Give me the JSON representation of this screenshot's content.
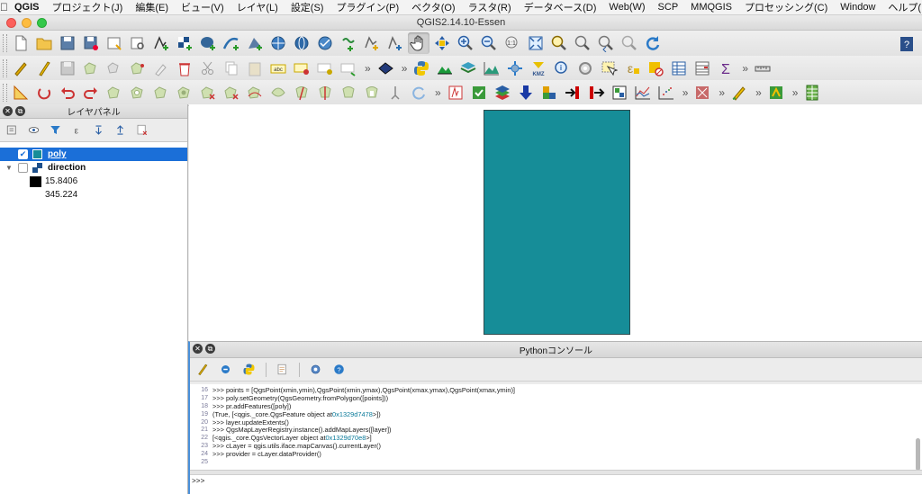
{
  "menubar": {
    "app": "QGIS",
    "items": [
      "プロジェクト(J)",
      "編集(E)",
      "ビュー(V)",
      "レイヤ(L)",
      "設定(S)",
      "プラグイン(P)",
      "ベクタ(O)",
      "ラスタ(R)",
      "データベース(D)",
      "Web(W)",
      "SCP",
      "MMQGIS",
      "プロセッシング(C)",
      "Window",
      "ヘルプ(H)"
    ]
  },
  "window": {
    "title": "QGIS2.14.10-Essen"
  },
  "layer_panel": {
    "title": "レイヤパネル",
    "layers": [
      {
        "name": "poly",
        "checked": true,
        "selected": true,
        "color": "#168d98"
      },
      {
        "name": "direction",
        "checked": false,
        "selected": false
      }
    ],
    "legend": [
      {
        "label": "15.8406",
        "color": "#000000"
      },
      {
        "label": "345.224",
        "color": "#ffffff"
      }
    ]
  },
  "map": {
    "polygon_color": "#168d98"
  },
  "console": {
    "title": "Pythonコンソール",
    "lines": [
      {
        "n": "16",
        "text": ">>> points = [QgsPoint(xmin,ymin),QgsPoint(xmin,ymax),QgsPoint(xmax,ymax),QgsPoint(xmax,ymin)]"
      },
      {
        "n": "17",
        "text": ">>> poly.setGeometry(QgsGeometry.fromPolygon([points]))"
      },
      {
        "n": "18",
        "text": ">>> pr.addFeatures([poly])"
      },
      {
        "n": "19",
        "text": "(True, [<qgis._core.QgsFeature object at ",
        "addr": "0x1329d7478",
        "tail": ">])"
      },
      {
        "n": "20",
        "text": ">>> layer.updateExtents()"
      },
      {
        "n": "21",
        "text": ">>> QgsMapLayerRegistry.instance().addMapLayers([layer])"
      },
      {
        "n": "22",
        "text": "[<qgis._core.QgsVectorLayer object at ",
        "addr": "0x1329d70e8",
        "tail": ">]"
      },
      {
        "n": "23",
        "text": ">>> cLayer = qgis.utils.iface.mapCanvas().currentLayer()"
      },
      {
        "n": "24",
        "text": ">>> provider = cLayer.dataProvider()"
      },
      {
        "n": "25",
        "text": ""
      }
    ],
    "prompt": ">>>"
  },
  "icons": {
    "toolbar1": [
      "new-project-icon",
      "open-project-icon",
      "save-project-icon",
      "save-as-icon",
      "new-print-composer-icon",
      "composer-manager-icon",
      "add-vector-layer-icon",
      "add-raster-layer-icon",
      "add-postgis-icon",
      "add-spatialite-icon",
      "add-mssql-icon",
      "add-wms-icon",
      "add-wcs-icon",
      "add-wfs-icon",
      "add-delimited-text-icon",
      "new-shapefile-icon",
      "new-spatialite-layer-icon",
      "pan-icon",
      "pan-to-selection-icon",
      "zoom-in-icon",
      "zoom-out-icon",
      "zoom-native-icon",
      "zoom-full-icon",
      "zoom-to-selection-icon",
      "zoom-to-layer-icon",
      "zoom-last-icon",
      "zoom-next-icon",
      "refresh-icon",
      "help-icon"
    ],
    "toolbar2": [
      "current-edits-icon",
      "toggle-editing-icon",
      "save-edits-icon",
      "add-feature-icon",
      "move-feature-icon",
      "node-tool-icon",
      "delete-selected-icon",
      "cut-features-icon",
      "copy-features-icon",
      "paste-features-icon",
      "label-icon",
      "pin-labels-icon",
      "show-hide-labels-icon",
      "move-label-icon",
      "python-console-icon",
      "raster-terrain-icon",
      "qgis-cloud-icon",
      "profile-icon",
      "gps-icon",
      "kmz-icon",
      "identify-icon",
      "select-icon",
      "select-by-expression-icon",
      "deselect-icon",
      "attribute-table-icon",
      "field-calculator-icon",
      "statistics-icon",
      "measure-icon"
    ],
    "toolbar3": [
      "digitize-icon",
      "rotate-icon",
      "undo-icon",
      "redo-icon",
      "simplify-icon",
      "add-ring-icon",
      "add-part-icon",
      "fill-ring-icon",
      "delete-ring-icon",
      "delete-part-icon",
      "reshape-icon",
      "offset-curve-icon",
      "split-features-icon",
      "split-parts-icon",
      "merge-features-icon",
      "merge-attributes-icon",
      "rotate-point-symbols-icon",
      "trace-icon",
      "scp-icon",
      "scp-classification-icon",
      "band-set-icon",
      "download-icon",
      "pointer-icon",
      "roi-icon",
      "pre-processing-icon",
      "post-processing-icon",
      "spectral-plot-icon",
      "scatter-plot-icon",
      "georeferencer-icon",
      "band-calc-icon",
      "settings-icon",
      "spreadsheet-icon"
    ]
  }
}
